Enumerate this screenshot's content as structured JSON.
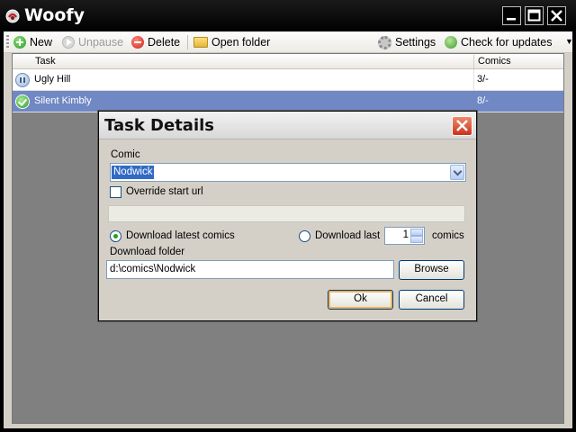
{
  "window": {
    "title": "Woofy"
  },
  "toolbar": {
    "new_label": "New",
    "unpause_label": "Unpause",
    "delete_label": "Delete",
    "open_folder_label": "Open folder",
    "settings_label": "Settings",
    "check_updates_label": "Check for updates"
  },
  "task_list": {
    "columns": [
      "Task",
      "Comics"
    ],
    "rows": [
      {
        "task": "Ugly Hill",
        "comics": "3/-",
        "status_icon": "paused-icon",
        "selected": false
      },
      {
        "task": "Silent Kimbly",
        "comics": "8/-",
        "status_icon": "completed-icon",
        "selected": true
      }
    ]
  },
  "dialog": {
    "title": "Task Details",
    "comic_label": "Comic",
    "comic_value": "Nodwick",
    "override_label": "Override start url",
    "override_checked": false,
    "start_url_value": "",
    "download_latest_label": "Download latest comics",
    "download_latest_selected": true,
    "download_last_label": "Download last",
    "download_last_count": "1",
    "comics_suffix": "comics",
    "download_folder_label": "Download folder",
    "download_folder_value": "d:\\comics\\Nodwick",
    "browse_label": "Browse",
    "ok_label": "Ok",
    "cancel_label": "Cancel"
  },
  "colors": {
    "selection": "#7088c4",
    "titlebar": "#000000",
    "dialog_close": "#c9321b"
  }
}
